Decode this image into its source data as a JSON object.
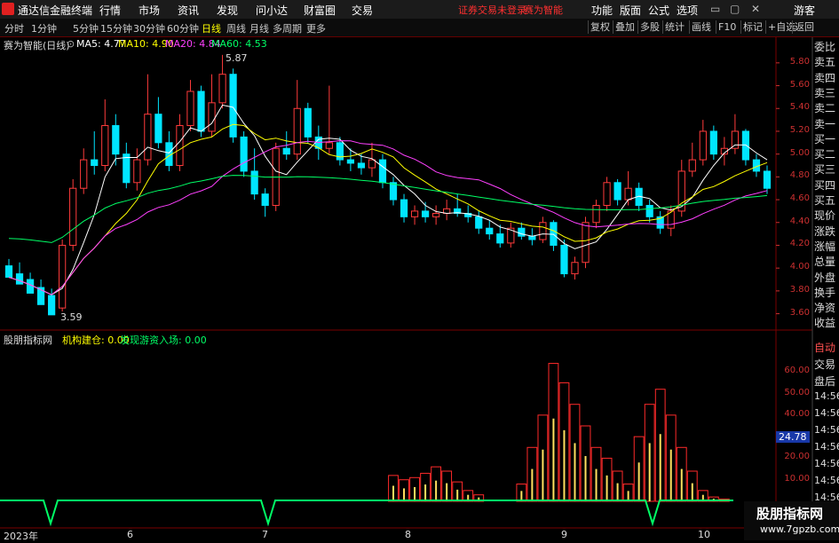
{
  "app": {
    "name": "通达信金融终端",
    "menus": [
      "行情",
      "市场",
      "资讯",
      "发现",
      "问小达",
      "财富圈",
      "交易"
    ],
    "warning": "证券交易未登录",
    "warning2": "赛为智能",
    "right_menus": [
      "功能",
      "版面",
      "公式",
      "选项"
    ],
    "user": "游客"
  },
  "toolbar": {
    "periods": [
      "分时",
      "1分钟",
      "5分钟",
      "15分钟",
      "30分钟",
      "60分钟",
      "日线",
      "周线",
      "月线",
      "多周期",
      "更多"
    ],
    "active": "日线",
    "right": [
      "复权",
      "叠加",
      "多股",
      "统计",
      "画线",
      "F10",
      "标记",
      "+自选",
      "返回"
    ]
  },
  "chart": {
    "stock": "赛为智能(日线)",
    "ma": {
      "ma5": "MA5: 4.77",
      "ma10": "MA10: 4.90",
      "ma20": "MA20: 4.84",
      "ma60": "MA60: 4.53"
    },
    "high_label": "5.87",
    "low_label": "3.59",
    "price_axis": [
      "5.80",
      "5.60",
      "5.40",
      "5.20",
      "5.00",
      "4.80",
      "4.60",
      "4.40",
      "4.20",
      "4.00",
      "3.80",
      "3.60"
    ],
    "colors": {
      "up": "#ff3b3b",
      "down": "#00e5ff",
      "ma5": "#ffffff",
      "ma10": "#ffff00",
      "ma20": "#ff40ff",
      "ma60": "#00ff66"
    }
  },
  "indicator": {
    "name": "股朋指标网",
    "line1": "机构建仓: 0.00",
    "line2": "发现游资入场: 0.00",
    "axis": [
      "60.00",
      "50.00",
      "40.00",
      "30.00",
      "20.00",
      "10.00"
    ],
    "current": "24.78"
  },
  "timeline": [
    "2023年",
    "6",
    "7",
    "8",
    "9",
    "10"
  ],
  "sidebar": [
    "委比",
    "卖五",
    "卖四",
    "卖三",
    "卖二",
    "卖一",
    "买一",
    "买二",
    "买三",
    "买四",
    "买五",
    "现价",
    "涨跌",
    "涨幅",
    "总量",
    "外盘",
    "换手",
    "净资",
    "收益"
  ],
  "sidebar2": [
    "自动",
    "交易",
    "盘后",
    "14:56",
    "14:56",
    "14:56",
    "14:56",
    "14:56",
    "14:56",
    "14:56"
  ],
  "brand": {
    "name": "股朋指标网",
    "url": "www.7gpzb.com"
  },
  "candles": [
    [
      4.02,
      4.08,
      3.97,
      3.92
    ],
    [
      3.95,
      4.05,
      3.9,
      3.86
    ],
    [
      3.9,
      3.96,
      3.82,
      3.78
    ],
    [
      3.83,
      3.9,
      3.73,
      3.68
    ],
    [
      3.76,
      3.82,
      3.62,
      3.59
    ],
    [
      3.65,
      4.25,
      3.62,
      4.2
    ],
    [
      4.2,
      4.78,
      4.15,
      4.7
    ],
    [
      4.7,
      5.05,
      4.65,
      4.95
    ],
    [
      4.95,
      5.2,
      4.82,
      4.9
    ],
    [
      4.9,
      5.48,
      4.85,
      5.25
    ],
    [
      5.25,
      5.35,
      4.9,
      5.0
    ],
    [
      5.0,
      5.1,
      4.7,
      4.75
    ],
    [
      4.75,
      5.05,
      4.68,
      4.95
    ],
    [
      4.95,
      5.7,
      4.9,
      5.35
    ],
    [
      5.35,
      5.5,
      5.05,
      5.1
    ],
    [
      5.1,
      5.2,
      4.85,
      4.9
    ],
    [
      4.9,
      5.35,
      4.85,
      5.25
    ],
    [
      5.25,
      5.65,
      5.2,
      5.55
    ],
    [
      5.55,
      5.6,
      5.15,
      5.2
    ],
    [
      5.2,
      5.7,
      5.15,
      5.45
    ],
    [
      5.45,
      5.87,
      5.4,
      5.7
    ],
    [
      5.7,
      5.75,
      5.1,
      5.15
    ],
    [
      5.15,
      5.2,
      4.8,
      4.85
    ],
    [
      4.85,
      5.05,
      4.6,
      4.65
    ],
    [
      4.65,
      4.7,
      4.45,
      4.55
    ],
    [
      4.55,
      5.1,
      4.5,
      5.05
    ],
    [
      5.05,
      5.2,
      4.95,
      5.0
    ],
    [
      5.0,
      5.65,
      4.95,
      5.4
    ],
    [
      5.4,
      5.45,
      5.1,
      5.15
    ],
    [
      5.15,
      5.25,
      4.95,
      5.05
    ],
    [
      5.05,
      5.6,
      5.0,
      5.1
    ],
    [
      5.1,
      5.15,
      4.9,
      4.95
    ],
    [
      4.95,
      5.05,
      4.85,
      4.92
    ],
    [
      4.92,
      5.0,
      4.82,
      4.88
    ],
    [
      4.88,
      5.1,
      4.8,
      4.95
    ],
    [
      4.95,
      5.0,
      4.7,
      4.75
    ],
    [
      4.75,
      4.8,
      4.55,
      4.6
    ],
    [
      4.6,
      4.65,
      4.4,
      4.45
    ],
    [
      4.45,
      4.55,
      4.38,
      4.5
    ],
    [
      4.5,
      4.58,
      4.4,
      4.45
    ],
    [
      4.45,
      4.55,
      4.38,
      4.48
    ],
    [
      4.48,
      4.6,
      4.42,
      4.52
    ],
    [
      4.52,
      4.65,
      4.45,
      4.48
    ],
    [
      4.48,
      4.55,
      4.4,
      4.45
    ],
    [
      4.45,
      4.5,
      4.3,
      4.35
    ],
    [
      4.35,
      4.42,
      4.25,
      4.3
    ],
    [
      4.3,
      4.38,
      4.18,
      4.22
    ],
    [
      4.22,
      4.4,
      4.18,
      4.35
    ],
    [
      4.35,
      4.4,
      4.25,
      4.28
    ],
    [
      4.28,
      4.35,
      4.2,
      4.25
    ],
    [
      4.25,
      4.45,
      4.22,
      4.4
    ],
    [
      4.4,
      4.42,
      4.15,
      4.2
    ],
    [
      4.2,
      4.25,
      3.92,
      3.95
    ],
    [
      3.95,
      4.1,
      3.9,
      4.05
    ],
    [
      4.05,
      4.45,
      4.0,
      4.4
    ],
    [
      4.4,
      4.6,
      4.35,
      4.55
    ],
    [
      4.55,
      4.8,
      4.5,
      4.75
    ],
    [
      4.75,
      4.78,
      4.55,
      4.6
    ],
    [
      4.6,
      4.85,
      4.55,
      4.7
    ],
    [
      4.7,
      4.75,
      4.5,
      4.55
    ],
    [
      4.55,
      4.6,
      4.4,
      4.45
    ],
    [
      4.45,
      4.5,
      4.3,
      4.35
    ],
    [
      4.35,
      4.55,
      4.28,
      4.5
    ],
    [
      4.5,
      4.95,
      4.45,
      4.85
    ],
    [
      4.85,
      5.1,
      4.8,
      4.95
    ],
    [
      4.95,
      5.3,
      4.9,
      5.2
    ],
    [
      5.2,
      5.25,
      4.95,
      5.0
    ],
    [
      5.0,
      5.15,
      4.9,
      5.05
    ],
    [
      5.05,
      5.35,
      5.0,
      5.2
    ],
    [
      5.2,
      5.22,
      4.9,
      4.95
    ],
    [
      4.95,
      5.0,
      4.8,
      4.85
    ],
    [
      4.85,
      4.9,
      4.65,
      4.7
    ]
  ],
  "vol": [
    0,
    0,
    0,
    0,
    0,
    0,
    0,
    0,
    0,
    0,
    0,
    0,
    0,
    0,
    0,
    0,
    0,
    0,
    0,
    0,
    0,
    0,
    0,
    0,
    0,
    0,
    0,
    0,
    0,
    0,
    0,
    0,
    0,
    0,
    0,
    0,
    12,
    10,
    11,
    13,
    16,
    14,
    9,
    5,
    3,
    0,
    0,
    0,
    8,
    25,
    40,
    64,
    55,
    45,
    35,
    25,
    20,
    14,
    8,
    30,
    45,
    52,
    40,
    25,
    14,
    5,
    2,
    1,
    0,
    0,
    0,
    0
  ]
}
